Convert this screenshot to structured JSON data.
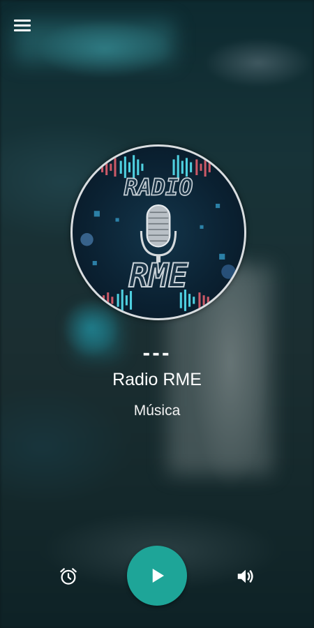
{
  "header": {
    "menu_icon": "hamburger-menu-icon"
  },
  "player": {
    "artwork": {
      "logo_text_top": "RADIO",
      "logo_text_bottom": "RME",
      "icon": "microphone-icon"
    },
    "now_playing": "---",
    "station_name": "Radio RME",
    "genre": "Música"
  },
  "controls": {
    "alarm_icon": "alarm-clock-icon",
    "play_icon": "play-icon",
    "volume_icon": "volume-icon",
    "accent_color": "#1ea598"
  }
}
